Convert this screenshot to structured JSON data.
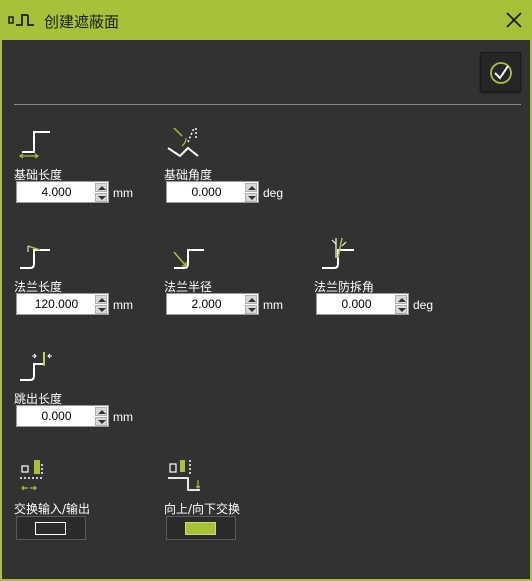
{
  "window": {
    "title": "创建遮蔽面"
  },
  "colors": {
    "accent": "#a7c23a",
    "background": "#323232"
  },
  "params": {
    "base_length": {
      "label": "基础长度",
      "value": "4.000",
      "unit": "mm",
      "icon": "base-length-icon"
    },
    "base_angle": {
      "label": "基础角度",
      "value": "0.000",
      "unit": "deg",
      "icon": "base-angle-icon"
    },
    "flange_length": {
      "label": "法兰长度",
      "value": "120.000",
      "unit": "mm",
      "icon": "flange-length-icon"
    },
    "flange_radius": {
      "label": "法兰半径",
      "value": "2.000",
      "unit": "mm",
      "icon": "flange-radius-icon"
    },
    "flange_draft": {
      "label": "法兰防拆角",
      "value": "0.000",
      "unit": "deg",
      "icon": "flange-draft-angle-icon"
    },
    "jog_length": {
      "label": "跳出长度",
      "value": "0.000",
      "unit": "mm",
      "icon": "jog-length-icon"
    }
  },
  "toggles": {
    "swap_in_out": {
      "label": "交换输入/输出",
      "state": "off",
      "color": "#ffffff",
      "icon": "swap-in-out-icon"
    },
    "swap_up_down": {
      "label": "向上/向下交换",
      "state": "on",
      "color": "#a7c23a",
      "icon": "swap-up-down-icon"
    }
  }
}
